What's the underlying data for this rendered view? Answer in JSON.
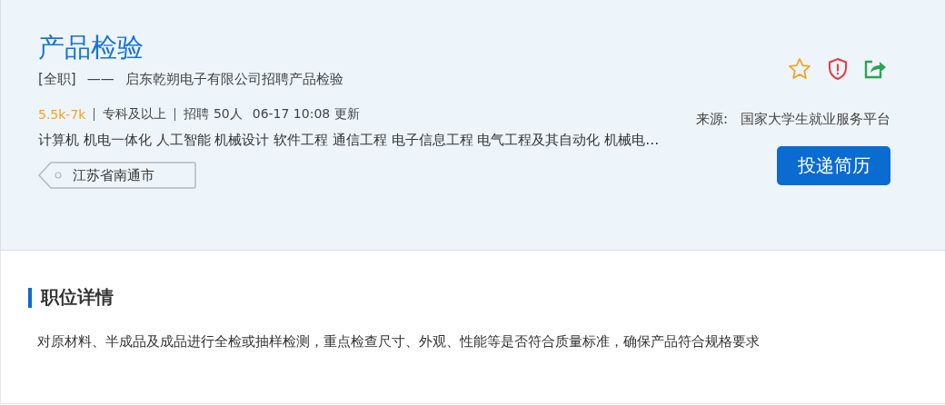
{
  "job": {
    "title": "产品检验",
    "employment_type": "[全职]",
    "separator": "——",
    "company_line": "启东乾朔电子有限公司招聘产品检验",
    "salary": "5.5k-7k",
    "education": "专科及以上",
    "headcount": "招聘 50人",
    "updated": "06-17 10:08 更新",
    "majors": "计算机 机电一体化 人工智能 机械设计 软件工程 通信工程 电子信息工程 电气工程及其自动化 机械电…",
    "location": "江苏省南通市",
    "source_label": "来源:",
    "source": "国家大学生就业服务平台",
    "apply_button": "投递简历",
    "favorited": false
  },
  "details": {
    "heading": "职位详情",
    "description": "对原材料、半成品及成品进行全检或抽样检测，重点检查尺寸、外观、性能等是否符合质量标准，确保产品符合规格要求"
  }
}
